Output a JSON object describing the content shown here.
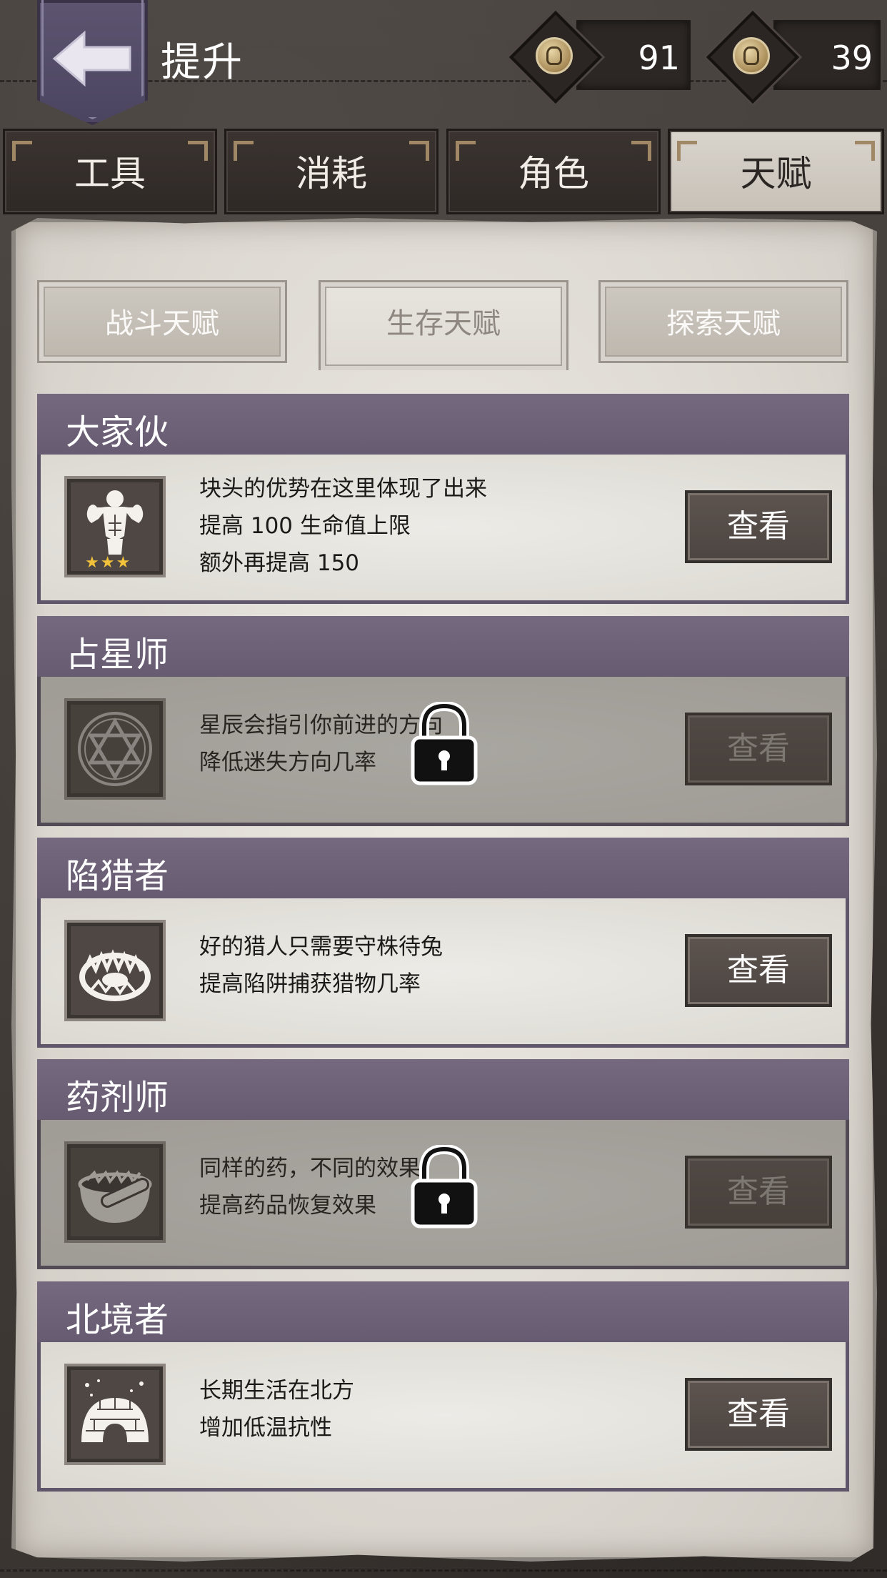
{
  "header": {
    "title": "提升",
    "currencies": [
      {
        "icon": "coin-icon",
        "value": "91"
      },
      {
        "icon": "coin-icon",
        "value": "39"
      }
    ]
  },
  "main_tabs": [
    {
      "label": "工具",
      "active": false
    },
    {
      "label": "消耗",
      "active": false
    },
    {
      "label": "角色",
      "active": false
    },
    {
      "label": "天赋",
      "active": true
    }
  ],
  "sub_tabs": [
    {
      "label": "战斗天赋",
      "active": false
    },
    {
      "label": "生存天赋",
      "active": true
    },
    {
      "label": "探索天赋",
      "active": false
    }
  ],
  "talents": [
    {
      "name": "大家伙",
      "icon": "muscle-man-icon",
      "lines": [
        "块头的优势在这里体现了出来",
        "提高 100 生命值上限",
        "额外再提高 150"
      ],
      "button": "查看",
      "locked": false,
      "stars": "★★★"
    },
    {
      "name": "占星师",
      "icon": "hexagram-icon",
      "lines": [
        "星辰会指引你前进的方向",
        "降低迷失方向几率"
      ],
      "button": "查看",
      "locked": true
    },
    {
      "name": "陷猎者",
      "icon": "bear-trap-icon",
      "lines": [
        "好的猎人只需要守株待兔",
        "提高陷阱捕获猎物几率"
      ],
      "button": "查看",
      "locked": false
    },
    {
      "name": "药剂师",
      "icon": "mortar-pestle-icon",
      "lines": [
        "同样的药，不同的效果",
        "提高药品恢复效果"
      ],
      "button": "查看",
      "locked": true
    },
    {
      "name": "北境者",
      "icon": "igloo-icon",
      "lines": [
        "长期生活在北方",
        "增加低温抗性"
      ],
      "button": "查看",
      "locked": false
    }
  ]
}
